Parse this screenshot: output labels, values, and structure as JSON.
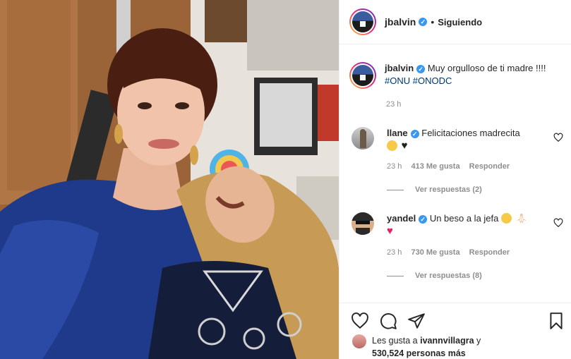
{
  "post": {
    "author": "jbalvin",
    "follow_status": "Siguiendo",
    "separator": "•"
  },
  "caption": {
    "username": "jbalvin",
    "text": "Muy orgulloso de ti madre !!!!",
    "hashtags": [
      "#ONU",
      "#ONODC"
    ],
    "timestamp": "23 h"
  },
  "comments": [
    {
      "username": "llane",
      "text": "Felicitaciones madrecita",
      "emojis": [
        "grin-emoji",
        "black-heart-emoji"
      ],
      "time": "23 h",
      "likes": "413 Me gusta",
      "reply": "Responder",
      "view_replies": "Ver respuestas (2)"
    },
    {
      "username": "yandel",
      "text": "Un beso a la jefa",
      "emojis": [
        "kiss-emoji",
        "pray-emoji",
        "red-heart-emoji"
      ],
      "time": "23 h",
      "likes": "730 Me gusta",
      "reply": "Responder",
      "view_replies": "Ver respuestas (8)"
    }
  ],
  "likes_summary": {
    "prefix": "Les gusta a",
    "user": "ivannvillagra",
    "suffix": "y",
    "count": "530,524",
    "more": "personas más"
  },
  "colors": {
    "verified": "#3897f0",
    "hashtag": "#00376b",
    "muted": "#8e8e8e",
    "text": "#262626"
  }
}
